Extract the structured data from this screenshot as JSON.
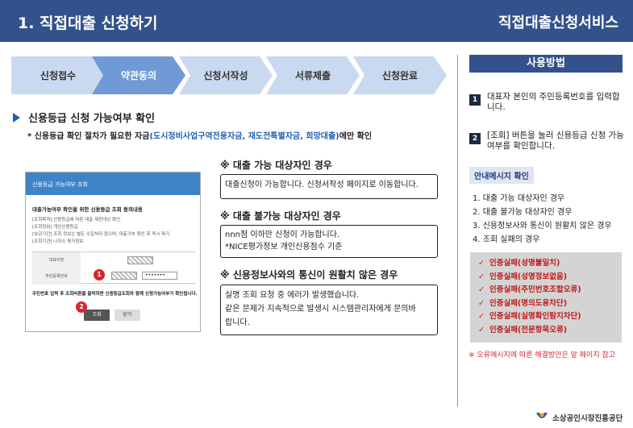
{
  "header": {
    "title": "1. 직접대출 신청하기",
    "service": "직접대출신청서비스"
  },
  "steps": [
    {
      "label": "신청접수",
      "active": false
    },
    {
      "label": "약관동의",
      "active": true
    },
    {
      "label": "신청서작성",
      "active": false
    },
    {
      "label": "서류제출",
      "active": false
    },
    {
      "label": "신청완료",
      "active": false
    }
  ],
  "section": {
    "title": "신용등급 신청 가능여부  확인",
    "note_prefix": "* 신용등급 확인 절차가 필요한 자금",
    "note_blue": "(도시정비사업구역전용자금, 재도전특별자금, 희망대출)",
    "note_suffix": "에만 확인"
  },
  "screenshot": {
    "bar": "신용등급 가능여부 조회",
    "heading": "대출가능여부 확인을 위한 신용등급 조회 동의내용",
    "lines": [
      "[조회목적] 신용등급에 따른 대출 제한대상 확인",
      "[조회정보] 개인신용등급",
      "[보관기간] 조회 정보는 별도 수집처리 않으며, 대출가부 확인 후 즉시 파기",
      "[조회기관] 나이스 평가정보"
    ],
    "label1": "대표자명",
    "label2": "주민등록번호",
    "pw": "•••••••",
    "warn": "주민번호 입력 후 조회버튼을 클릭하면 신용등급조회와 함께 신청가능여부가 확인됩니다.",
    "btn1": "조회",
    "btn2": "닫기",
    "n1": "1",
    "n2": "2"
  },
  "cases": [
    {
      "title": "※ 대출 가능 대상자인 경우",
      "lines": [
        "대출신청이 가능합니다. 신청서작성 페이지로 이동합니다."
      ]
    },
    {
      "title": "※ 대출 불가능 대상자인 경우",
      "lines": [
        "nnn점 이하만 신청이 가능합니다.",
        "*NICE평가정보 개인신용점수 기준"
      ]
    },
    {
      "title": "※ 신용정보사와의 통신이 원활치 않은 경우",
      "lines": [
        "실명 조회 요청 중 에러가 발생했습니다.",
        "같은 문제가 지속적으로 발생시 시스템관리자에게 문의바",
        "랍니다."
      ]
    }
  ],
  "usage": {
    "title": "사용방법",
    "items": [
      {
        "num": "1",
        "text": "대표자 본인의 주민등록번호를 입력합니다."
      },
      {
        "num": "2",
        "text": "[조회] 버튼을 눌러 신용등급 신청 가능여부를 확인합니다."
      }
    ],
    "msg_title": "안내메시지 확인",
    "msg_list": [
      "1.  대출 가능 대상자인 경우",
      "2.  대출 불가능 대상자인 경우",
      "3.  신용정보사와 통신이 원활치 않은 경우",
      "4.  조회 실패의 경우"
    ],
    "errors": [
      "인증실패(성명불일치)",
      "인증실패(성명정보없음)",
      "인증실패(주민번호조합오류)",
      "인증실패(명의도용차단)",
      "인증실패(실명확인탐지차단)",
      "인증실패(전문항목오류)"
    ],
    "footnote": "※ 오류메시지에 따른 해결방안은 앞 페이지 참고"
  },
  "footer": {
    "org": "소상공인시장진흥공단"
  },
  "colors": {
    "header": "#33528c",
    "step": "#c9daf0",
    "step_active": "#6f9ad6",
    "accent_red": "#d7252c"
  }
}
